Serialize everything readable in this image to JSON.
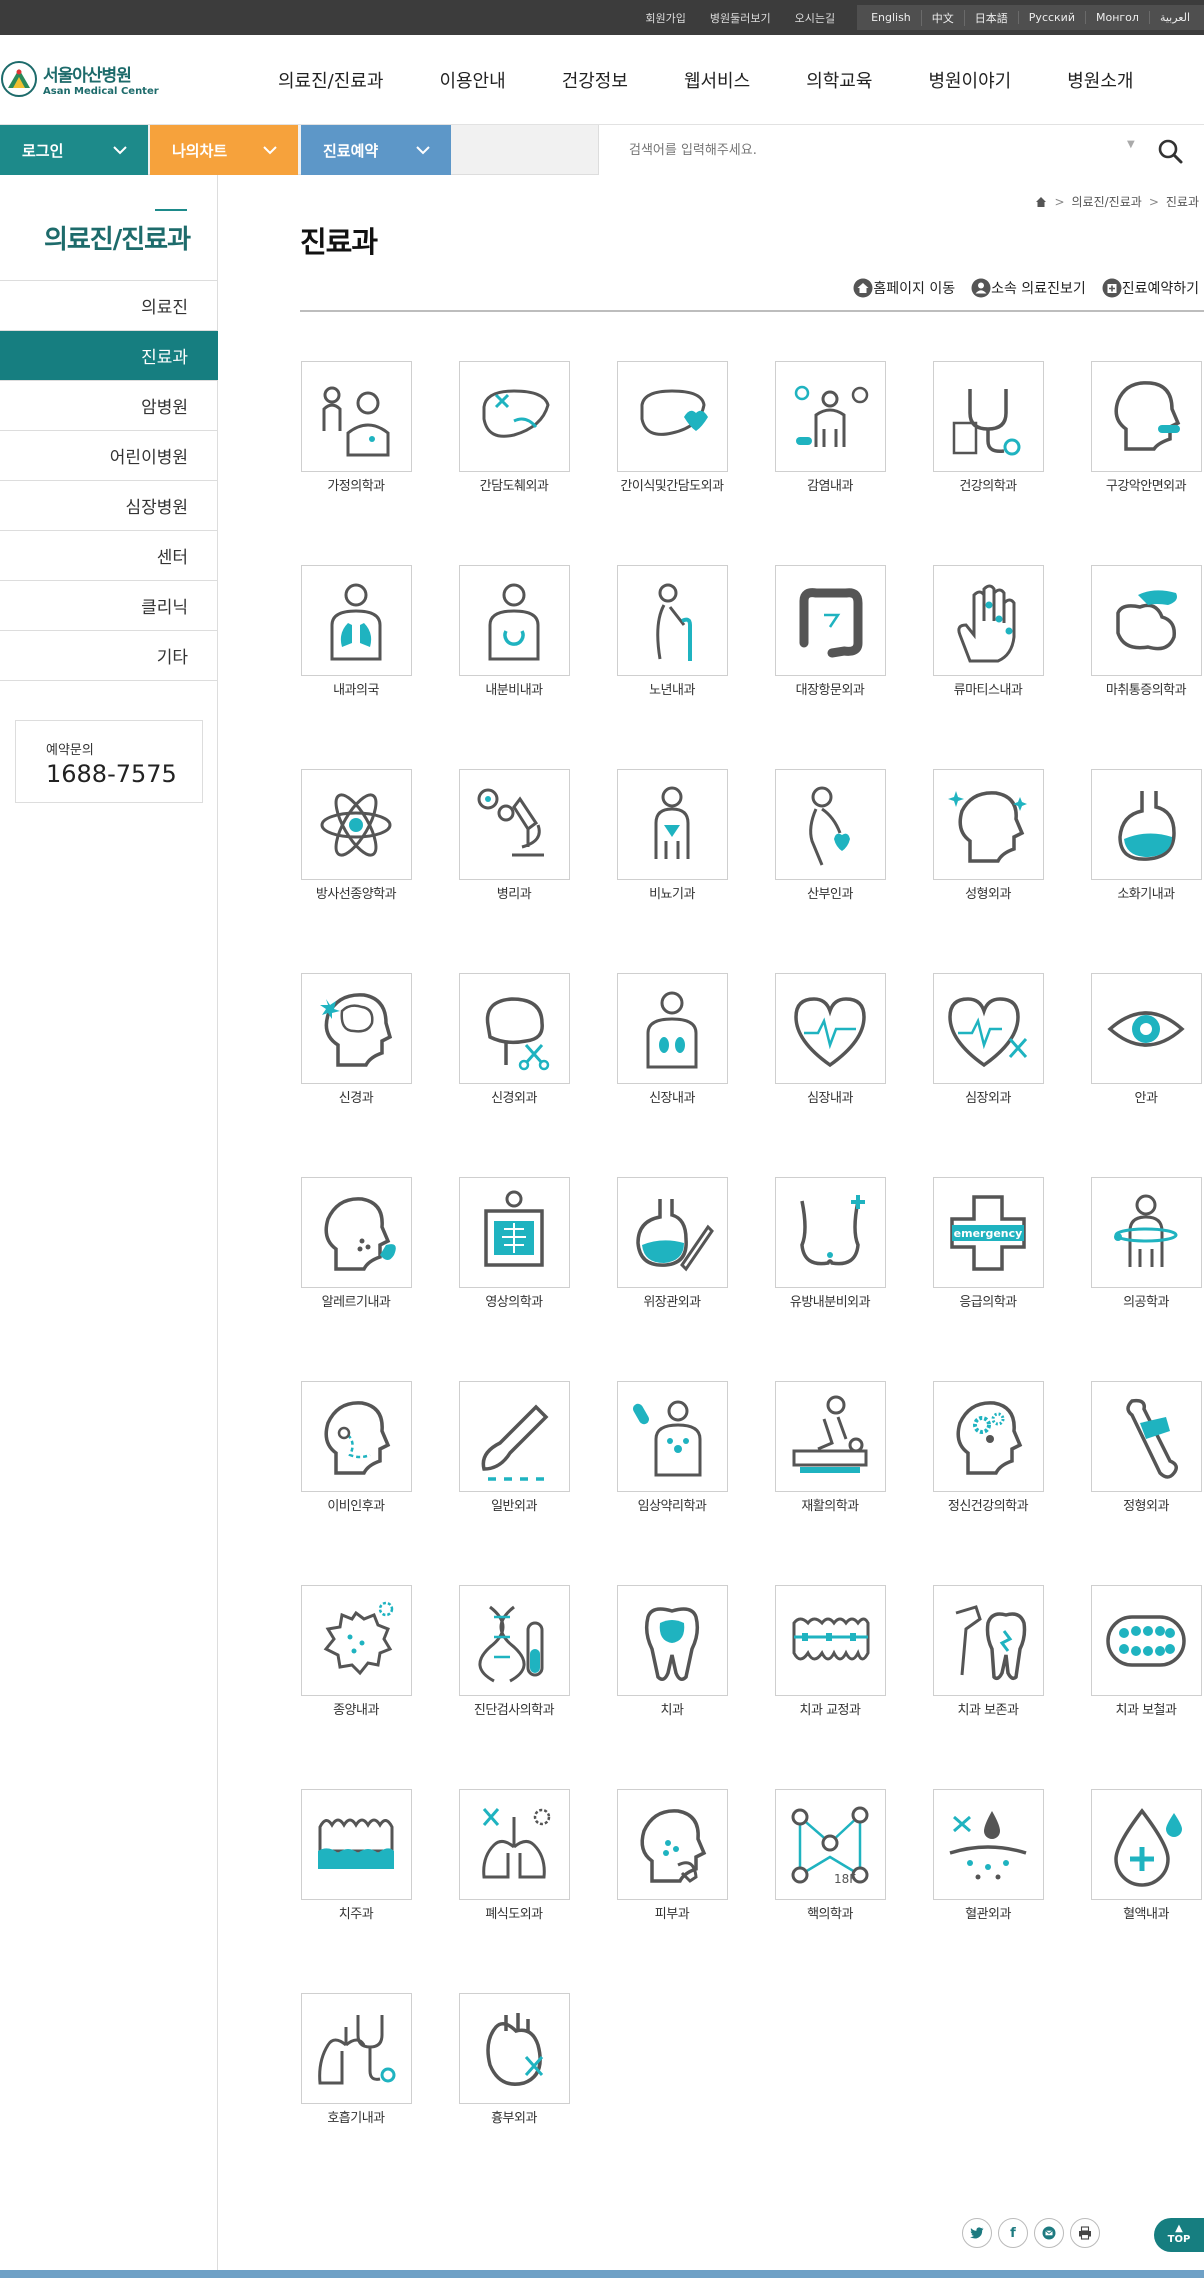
{
  "topbar": {
    "util_links": [
      "회원가입",
      "병원둘러보기",
      "오시는길"
    ],
    "languages": [
      "English",
      "中文",
      "日本語",
      "Русский",
      "Монгол",
      "العربية"
    ]
  },
  "logo": {
    "ko": "서울아산병원",
    "en": "Asan Medical Center"
  },
  "gnb": [
    "의료진/진료과",
    "이용안내",
    "건강정보",
    "웹서비스",
    "의학교육",
    "병원이야기",
    "병원소개"
  ],
  "quick": {
    "login": "로그인",
    "mychart": "나의차트",
    "reserve": "진료예약"
  },
  "search": {
    "placeholder": "검색어를 입력해주세요."
  },
  "lnb": {
    "title": "의료진/진료과",
    "items": [
      "의료진",
      "진료과",
      "암병원",
      "어린이병원",
      "심장병원",
      "센터",
      "클리닉",
      "기타"
    ],
    "active": "진료과"
  },
  "reservation": {
    "label": "예약문의",
    "tel": "1688-7575"
  },
  "breadcrumb": [
    "의료진/진료과",
    "진료과"
  ],
  "page": {
    "title": "진료과"
  },
  "actions": [
    "홈페이지 이동",
    "소속 의료진보기",
    "진료예약하기"
  ],
  "departments": [
    {
      "name": "가정의학과",
      "icon": "family-doctor-icon"
    },
    {
      "name": "간담도췌외과",
      "icon": "liver-surgery-icon"
    },
    {
      "name": "간이식및간담도외과",
      "icon": "liver-transplant-icon"
    },
    {
      "name": "감염내과",
      "icon": "infection-icon"
    },
    {
      "name": "건강의학과",
      "icon": "stethoscope-icon"
    },
    {
      "name": "구강악안면외과",
      "icon": "face-mouth-icon"
    },
    {
      "name": "내과의국",
      "icon": "lungs-body-icon"
    },
    {
      "name": "내분비내과",
      "icon": "thyroid-body-icon"
    },
    {
      "name": "노년내과",
      "icon": "elderly-cane-icon"
    },
    {
      "name": "대장항문외과",
      "icon": "colon-icon"
    },
    {
      "name": "류마티스내과",
      "icon": "hand-joints-icon"
    },
    {
      "name": "마취통증의학과",
      "icon": "anesthesia-icon"
    },
    {
      "name": "방사선종양학과",
      "icon": "atom-icon"
    },
    {
      "name": "병리과",
      "icon": "microscope-icon"
    },
    {
      "name": "비뇨기과",
      "icon": "urology-body-icon"
    },
    {
      "name": "산부인과",
      "icon": "pregnant-icon"
    },
    {
      "name": "성형외과",
      "icon": "face-sparkle-icon"
    },
    {
      "name": "소화기내과",
      "icon": "stomach-icon"
    },
    {
      "name": "신경과",
      "icon": "brain-head-icon"
    },
    {
      "name": "신경외과",
      "icon": "brain-scissors-icon"
    },
    {
      "name": "신장내과",
      "icon": "kidney-body-icon"
    },
    {
      "name": "심장내과",
      "icon": "heart-pulse-icon"
    },
    {
      "name": "심장외과",
      "icon": "heart-surgery-icon"
    },
    {
      "name": "안과",
      "icon": "eye-icon"
    },
    {
      "name": "알레르기내과",
      "icon": "allergy-head-icon"
    },
    {
      "name": "영상의학과",
      "icon": "xray-icon"
    },
    {
      "name": "위장관외과",
      "icon": "stomach-scalpel-icon"
    },
    {
      "name": "유방내분비외과",
      "icon": "breast-icon"
    },
    {
      "name": "응급의학과",
      "icon": "emergency-cross-icon"
    },
    {
      "name": "의공학과",
      "icon": "biomedical-body-icon"
    },
    {
      "name": "이비인후과",
      "icon": "ent-head-icon"
    },
    {
      "name": "일반외과",
      "icon": "scalpel-icon"
    },
    {
      "name": "임상약리학과",
      "icon": "pharmacology-icon"
    },
    {
      "name": "재활의학과",
      "icon": "rehab-icon"
    },
    {
      "name": "정신건강의학과",
      "icon": "mind-gears-icon"
    },
    {
      "name": "정형외과",
      "icon": "bone-bandage-icon"
    },
    {
      "name": "종양내과",
      "icon": "tumor-cell-icon"
    },
    {
      "name": "진단검사의학과",
      "icon": "dna-tube-icon"
    },
    {
      "name": "치과",
      "icon": "tooth-icon"
    },
    {
      "name": "치과 교정과",
      "icon": "braces-icon"
    },
    {
      "name": "치과 보존과",
      "icon": "dental-drill-icon"
    },
    {
      "name": "치과 보철과",
      "icon": "denture-icon"
    },
    {
      "name": "치주과",
      "icon": "gum-icon"
    },
    {
      "name": "폐식도외과",
      "icon": "lung-surgery-icon"
    },
    {
      "name": "피부과",
      "icon": "dermatology-icon"
    },
    {
      "name": "핵의학과",
      "icon": "nuclear-graph-icon"
    },
    {
      "name": "혈관외과",
      "icon": "vascular-icon"
    },
    {
      "name": "혈액내과",
      "icon": "blood-drop-icon"
    },
    {
      "name": "호흡기내과",
      "icon": "lungs-stethoscope-icon"
    },
    {
      "name": "흉부외과",
      "icon": "thoracic-heart-icon"
    }
  ],
  "share": [
    "twitter-icon",
    "facebook-icon",
    "mail-icon",
    "print-icon"
  ],
  "top_button": "TOP",
  "colors": {
    "teal": "#167e80",
    "orange": "#f6a23c",
    "blue": "#5d97c8",
    "accent": "#1fb3c0"
  }
}
